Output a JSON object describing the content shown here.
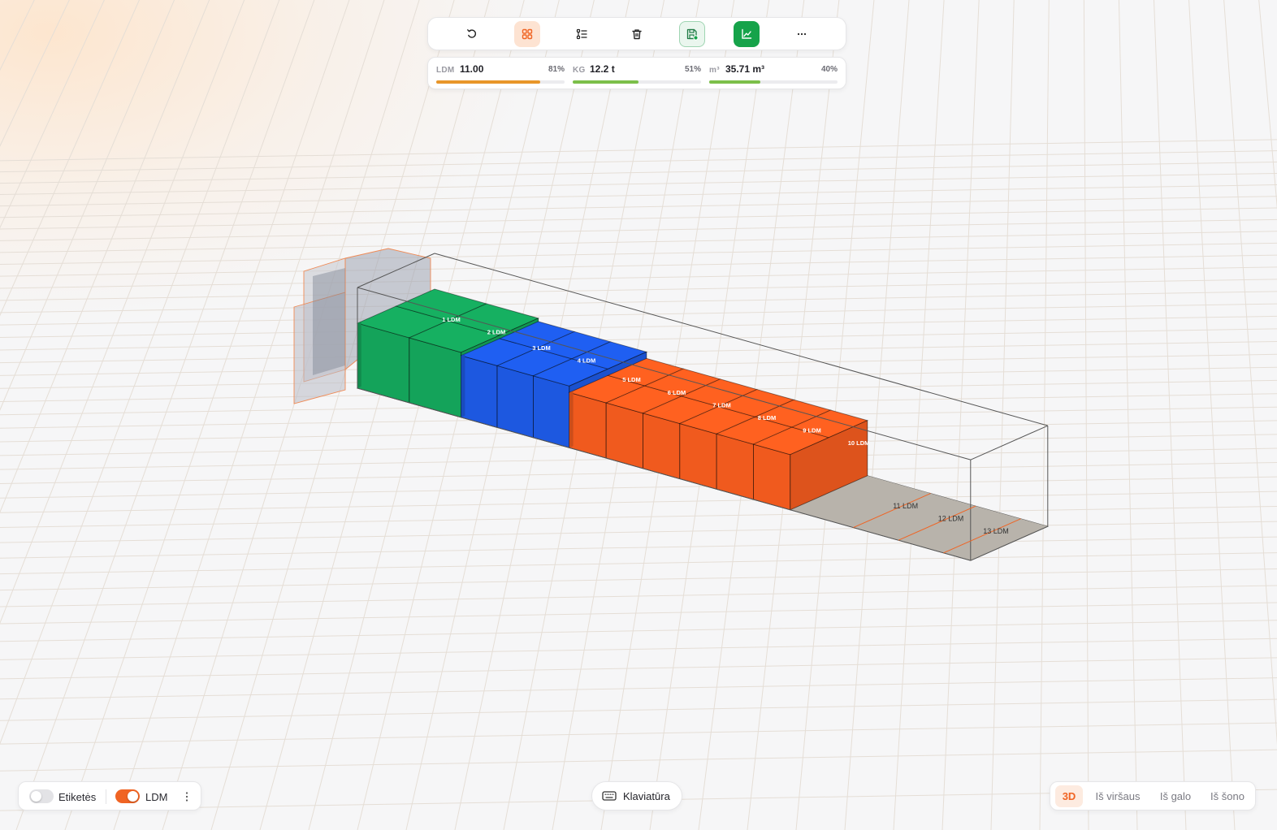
{
  "toolbar": {
    "buttons": [
      {
        "name": "undo",
        "icon": "undo-icon"
      },
      {
        "name": "grid-view",
        "icon": "grid-icon",
        "active": true
      },
      {
        "name": "list-view",
        "icon": "list-icon"
      },
      {
        "name": "delete",
        "icon": "trash-icon"
      },
      {
        "name": "save",
        "icon": "save-icon"
      },
      {
        "name": "chart",
        "icon": "chart-icon"
      },
      {
        "name": "more",
        "icon": "more-horizontal-icon"
      }
    ]
  },
  "stats": {
    "ldm": {
      "label": "LDM",
      "value": "11.00",
      "percent_label": "81%",
      "fraction": 0.81,
      "color": "#e8962a"
    },
    "kg": {
      "label": "KG",
      "value": "12.2 t",
      "percent_label": "51%",
      "fraction": 0.51,
      "color": "#7cbf4a"
    },
    "volume": {
      "label": "m³",
      "value": "35.71 m³",
      "percent_label": "40%",
      "fraction": 0.4,
      "color": "#7cbf4a"
    }
  },
  "scene": {
    "ldm_marks": [
      "1 LDM",
      "2 LDM",
      "3 LDM",
      "4 LDM",
      "5 LDM",
      "6 LDM",
      "7 LDM",
      "8 LDM",
      "9 LDM",
      "10 LDM",
      "11 LDM",
      "12 LDM",
      "13 LDM"
    ],
    "colors": {
      "green": "#14a35a",
      "blue": "#1d58e0",
      "orange": "#f05a1e",
      "floor": "#b8b3ab"
    }
  },
  "bottom_left": {
    "labels_toggle": {
      "label": "Etiketės",
      "on": false
    },
    "ldm_toggle": {
      "label": "LDM",
      "on": true
    }
  },
  "keyboard": {
    "label": "Klaviatūra",
    "icon": "keyboard-icon"
  },
  "views": {
    "items": [
      {
        "label": "3D",
        "active": true
      },
      {
        "label": "Iš viršaus",
        "active": false
      },
      {
        "label": "Iš galo",
        "active": false
      },
      {
        "label": "Iš šono",
        "active": false
      }
    ]
  }
}
